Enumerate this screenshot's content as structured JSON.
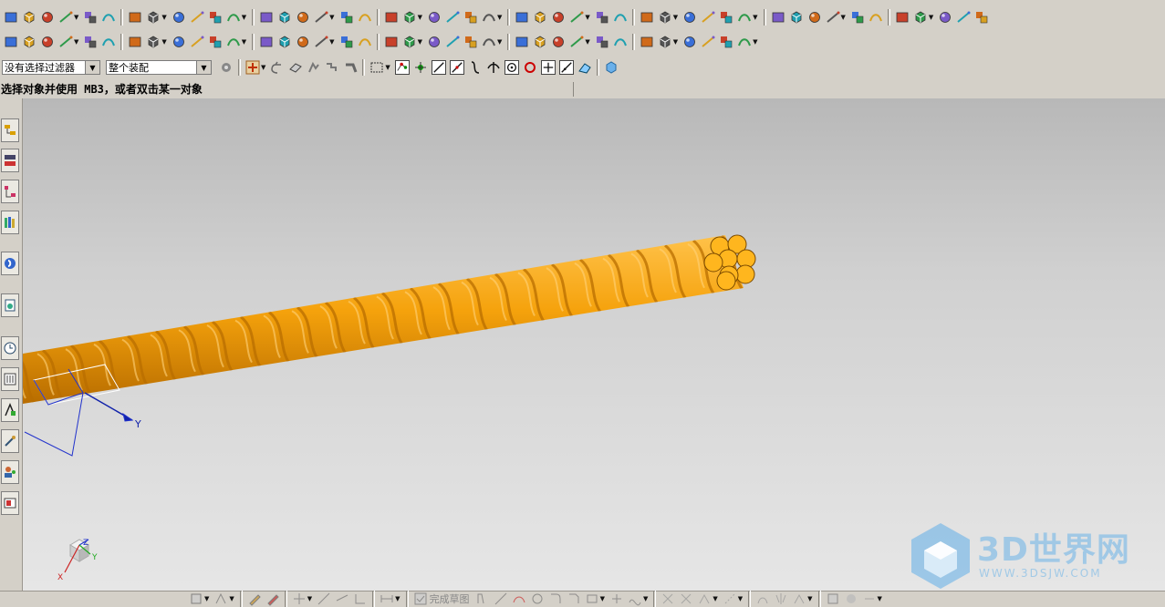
{
  "toolbars": {
    "row1": [
      "new-icon",
      "open-icon",
      "save-icon",
      "part-icon",
      "part2-icon",
      "part3-icon",
      "assembly-icon",
      "feature-icon",
      "shape-icon",
      "drafting-icon",
      "book-icon",
      "view-icon",
      "layer-icon",
      "sweep-icon",
      "brush-icon",
      "erase-icon",
      "extrude-icon",
      "block-icon",
      "face-icon",
      "solid-icon",
      "solid2-icon",
      "sheet-icon",
      "blend-icon",
      "chamfer-icon",
      "sphere-icon",
      "cube-icon",
      "cone-icon",
      "cylinder-icon",
      "torus-icon",
      "mesh-icon",
      "pad-icon",
      "boss-icon",
      "pocket-icon",
      "slot-icon",
      "groove-icon",
      "hole-icon",
      "thread-icon",
      "shell-icon",
      "draft-icon",
      "trim-icon",
      "offset-icon",
      "scale-icon",
      "pattern-icon",
      "mirror-icon",
      "sew-icon",
      "patch-icon",
      "render-icon"
    ],
    "row2": [
      "line-icon",
      "arc-icon",
      "rectangle-icon",
      "spline-icon",
      "polygon-icon",
      "point-icon",
      "fillet-icon",
      "chamfer2-icon",
      "edit-curve-icon",
      "text-icon",
      "curve-offset-icon",
      "project-icon",
      "bridge-icon",
      "combined-icon",
      "shade-icon",
      "sphere2-icon",
      "sphere3-icon",
      "circle-slash-icon",
      "square-fill-icon",
      "select-hand-icon",
      "person-icon",
      "plane-icon",
      "flatten-icon",
      "nodes-icon",
      "no-icon",
      "key-icon",
      "move-icon",
      "rotate-icon",
      "measure-icon",
      "analysis-icon",
      "surface-icon",
      "layer2-icon",
      "material-icon",
      "color-icon",
      "text-fmt-icon",
      "text2-icon"
    ],
    "row3_selects": {
      "filter": "没有选择过滤器",
      "scope": "整个装配"
    }
  },
  "status": {
    "cue": "选择对象并使用 MB3，或者双击某一对象"
  },
  "viewport": {
    "axis_y": "Y",
    "triad_x": "X",
    "triad_y": "Y",
    "triad_z": "Z"
  },
  "bottom": {
    "finish_sketch": "完成草图"
  },
  "watermark": {
    "brand": "3D世界网",
    "url": "WWW.3DSJW.COM"
  },
  "colors": {
    "rope": "#f5a20c",
    "rope_dark": "#b86d00",
    "watermark": "#6bb3e8"
  }
}
